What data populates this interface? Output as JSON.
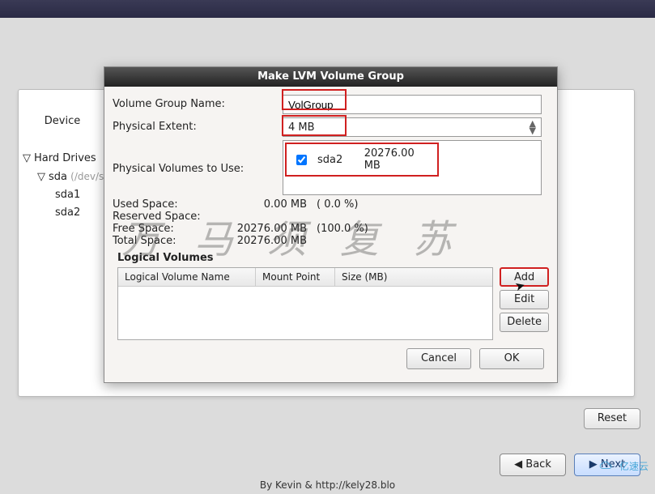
{
  "topbar": {},
  "main": {
    "device_header": "Device",
    "tree": {
      "root": "Hard Drives",
      "disk": "sda",
      "disk_dim": "(/dev/sda",
      "parts": [
        "sda1",
        "sda2"
      ]
    },
    "reset": "Reset"
  },
  "nav": {
    "back": "Back",
    "next": "Next"
  },
  "footer": "By Kevin & http://kely28.blo",
  "brand": "亿速云",
  "watermark": "万马须复苏",
  "dialog": {
    "title": "Make LVM Volume Group",
    "vg_label": "Volume Group Name:",
    "vg_value": "VolGroup",
    "pe_label": "Physical Extent:",
    "pe_value": "4 MB",
    "pv_label": "Physical Volumes to Use:",
    "pv_item_name": "sda2",
    "pv_item_size": "20276.00 MB",
    "stats": {
      "used_label": "Used Space:",
      "used_val": "0.00 MB",
      "used_pct": "( 0.0 %)",
      "reserved_label": "Reserved Space:",
      "free_label": "Free Space:",
      "free_val": "20276.00 MB",
      "free_pct": "(100.0 %)",
      "total_label": "Total Space:",
      "total_val": "20276.00 MB"
    },
    "lv_header": "Logical Volumes",
    "lv_cols": {
      "name": "Logical Volume Name",
      "mount": "Mount Point",
      "size": "Size (MB)"
    },
    "buttons": {
      "add": "Add",
      "edit": "Edit",
      "delete": "Delete"
    },
    "actions": {
      "cancel": "Cancel",
      "ok": "OK"
    }
  }
}
